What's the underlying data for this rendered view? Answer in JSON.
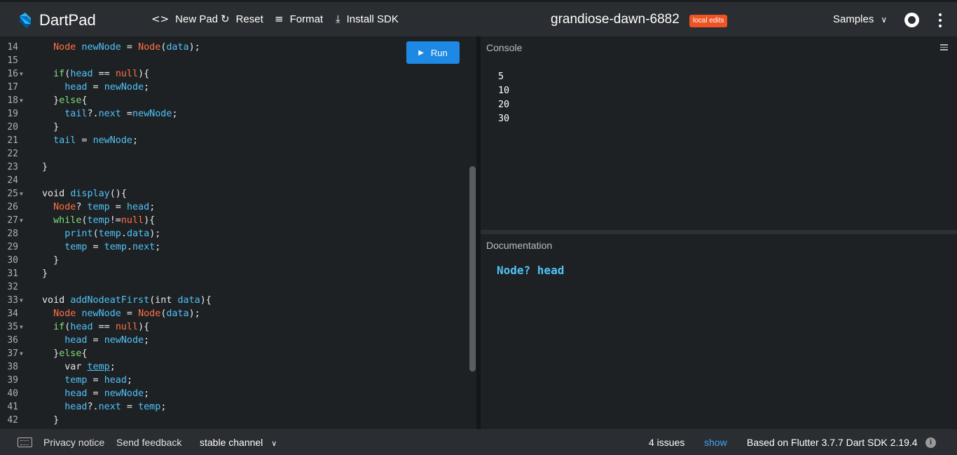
{
  "header": {
    "app_name": "DartPad",
    "new_pad": "New Pad",
    "reset": "Reset",
    "format": "Format",
    "install_sdk": "Install SDK",
    "pad_title": "grandiose-dawn-6882",
    "badge": "local edits",
    "samples": "Samples",
    "icons": {
      "new_pad": "code-icon",
      "reset": "refresh-icon",
      "format": "format-lines-icon",
      "install": "download-icon"
    },
    "colors": {
      "badge": "#ef5323",
      "brand": "#29b6f6"
    }
  },
  "editor": {
    "run_label": "Run",
    "run_color": "#1e88e5",
    "lines": [
      {
        "n": "14",
        "fold": false,
        "tokens": [
          [
            "k",
            "  Node "
          ],
          [
            "c",
            "newNode"
          ],
          [
            "w",
            " = "
          ],
          [
            "k",
            "Node"
          ],
          [
            "w",
            "("
          ],
          [
            "c",
            "data"
          ],
          [
            "w",
            ");"
          ]
        ]
      },
      {
        "n": "15",
        "fold": false,
        "tokens": []
      },
      {
        "n": "16",
        "fold": true,
        "tokens": [
          [
            "g",
            "  if"
          ],
          [
            "w",
            "("
          ],
          [
            "c",
            "head"
          ],
          [
            "w",
            " == "
          ],
          [
            "k",
            "null"
          ],
          [
            "w",
            "){"
          ]
        ]
      },
      {
        "n": "17",
        "fold": false,
        "tokens": [
          [
            "c",
            "    head"
          ],
          [
            "w",
            " = "
          ],
          [
            "c",
            "newNode"
          ],
          [
            "w",
            ";"
          ]
        ]
      },
      {
        "n": "18",
        "fold": true,
        "tokens": [
          [
            "w",
            "  }"
          ],
          [
            "g",
            "else"
          ],
          [
            "w",
            "{"
          ]
        ]
      },
      {
        "n": "19",
        "fold": false,
        "tokens": [
          [
            "c",
            "    tail"
          ],
          [
            "w",
            "?."
          ],
          [
            "c",
            "next"
          ],
          [
            "w",
            " ="
          ],
          [
            "c",
            "newNode"
          ],
          [
            "w",
            ";"
          ]
        ]
      },
      {
        "n": "20",
        "fold": false,
        "tokens": [
          [
            "w",
            "  }"
          ]
        ]
      },
      {
        "n": "21",
        "fold": false,
        "tokens": [
          [
            "c",
            "  tail"
          ],
          [
            "w",
            " = "
          ],
          [
            "c",
            "newNode"
          ],
          [
            "w",
            ";"
          ]
        ]
      },
      {
        "n": "22",
        "fold": false,
        "tokens": []
      },
      {
        "n": "23",
        "fold": false,
        "tokens": [
          [
            "w",
            "}"
          ]
        ]
      },
      {
        "n": "24",
        "fold": false,
        "tokens": []
      },
      {
        "n": "25",
        "fold": true,
        "tokens": [
          [
            "w",
            "void "
          ],
          [
            "c",
            "display"
          ],
          [
            "w",
            "(){"
          ]
        ]
      },
      {
        "n": "26",
        "fold": false,
        "tokens": [
          [
            "k",
            "  Node"
          ],
          [
            "w",
            "? "
          ],
          [
            "c",
            "temp"
          ],
          [
            "w",
            " = "
          ],
          [
            "c",
            "head"
          ],
          [
            "w",
            ";"
          ]
        ]
      },
      {
        "n": "27",
        "fold": true,
        "tokens": [
          [
            "g",
            "  while"
          ],
          [
            "w",
            "("
          ],
          [
            "c",
            "temp"
          ],
          [
            "w",
            "!="
          ],
          [
            "k",
            "null"
          ],
          [
            "w",
            "){"
          ]
        ]
      },
      {
        "n": "28",
        "fold": false,
        "tokens": [
          [
            "c",
            "    print"
          ],
          [
            "w",
            "("
          ],
          [
            "c",
            "temp"
          ],
          [
            "w",
            "."
          ],
          [
            "c",
            "data"
          ],
          [
            "w",
            ");"
          ]
        ]
      },
      {
        "n": "29",
        "fold": false,
        "tokens": [
          [
            "c",
            "    temp"
          ],
          [
            "w",
            " = "
          ],
          [
            "c",
            "temp"
          ],
          [
            "w",
            "."
          ],
          [
            "c",
            "next"
          ],
          [
            "w",
            ";"
          ]
        ]
      },
      {
        "n": "30",
        "fold": false,
        "tokens": [
          [
            "w",
            "  }"
          ]
        ]
      },
      {
        "n": "31",
        "fold": false,
        "tokens": [
          [
            "w",
            "}"
          ]
        ]
      },
      {
        "n": "32",
        "fold": false,
        "tokens": []
      },
      {
        "n": "33",
        "fold": true,
        "tokens": [
          [
            "w",
            "void "
          ],
          [
            "c",
            "addNodeatFirst"
          ],
          [
            "w",
            "(int "
          ],
          [
            "c",
            "data"
          ],
          [
            "w",
            "){"
          ]
        ]
      },
      {
        "n": "34",
        "fold": false,
        "tokens": [
          [
            "k",
            "  Node "
          ],
          [
            "c",
            "newNode"
          ],
          [
            "w",
            " = "
          ],
          [
            "k",
            "Node"
          ],
          [
            "w",
            "("
          ],
          [
            "c",
            "data"
          ],
          [
            "w",
            ");"
          ]
        ]
      },
      {
        "n": "35",
        "fold": true,
        "tokens": [
          [
            "g",
            "  if"
          ],
          [
            "w",
            "("
          ],
          [
            "c",
            "head"
          ],
          [
            "w",
            " == "
          ],
          [
            "k",
            "null"
          ],
          [
            "w",
            "){"
          ]
        ]
      },
      {
        "n": "36",
        "fold": false,
        "tokens": [
          [
            "c",
            "    head"
          ],
          [
            "w",
            " = "
          ],
          [
            "c",
            "newNode"
          ],
          [
            "w",
            ";"
          ]
        ]
      },
      {
        "n": "37",
        "fold": true,
        "tokens": [
          [
            "w",
            "  }"
          ],
          [
            "g",
            "else"
          ],
          [
            "w",
            "{"
          ]
        ]
      },
      {
        "n": "38",
        "fold": false,
        "tokens": [
          [
            "w",
            "    var "
          ],
          [
            "u",
            "temp"
          ],
          [
            "w",
            ";"
          ]
        ]
      },
      {
        "n": "39",
        "fold": false,
        "tokens": [
          [
            "c",
            "    temp"
          ],
          [
            "w",
            " = "
          ],
          [
            "c",
            "head"
          ],
          [
            "w",
            ";"
          ]
        ]
      },
      {
        "n": "40",
        "fold": false,
        "tokens": [
          [
            "c",
            "    head"
          ],
          [
            "w",
            " = "
          ],
          [
            "c",
            "newNode"
          ],
          [
            "w",
            ";"
          ]
        ]
      },
      {
        "n": "41",
        "fold": false,
        "tokens": [
          [
            "c",
            "    head"
          ],
          [
            "w",
            "?."
          ],
          [
            "c",
            "next"
          ],
          [
            "w",
            " = "
          ],
          [
            "c",
            "temp"
          ],
          [
            "w",
            ";"
          ]
        ]
      },
      {
        "n": "42",
        "fold": false,
        "tokens": [
          [
            "w",
            "  }"
          ]
        ]
      }
    ]
  },
  "console": {
    "title": "Console",
    "output": [
      "5",
      "10",
      "20",
      "30"
    ]
  },
  "documentation": {
    "title": "Documentation",
    "signature": "Node? head"
  },
  "status": {
    "privacy": "Privacy notice",
    "feedback": "Send feedback",
    "channel": "stable channel",
    "issues": "4 issues",
    "show": "show",
    "sdk": "Based on Flutter 3.7.7 Dart SDK 2.19.4",
    "info_glyph": "i"
  }
}
